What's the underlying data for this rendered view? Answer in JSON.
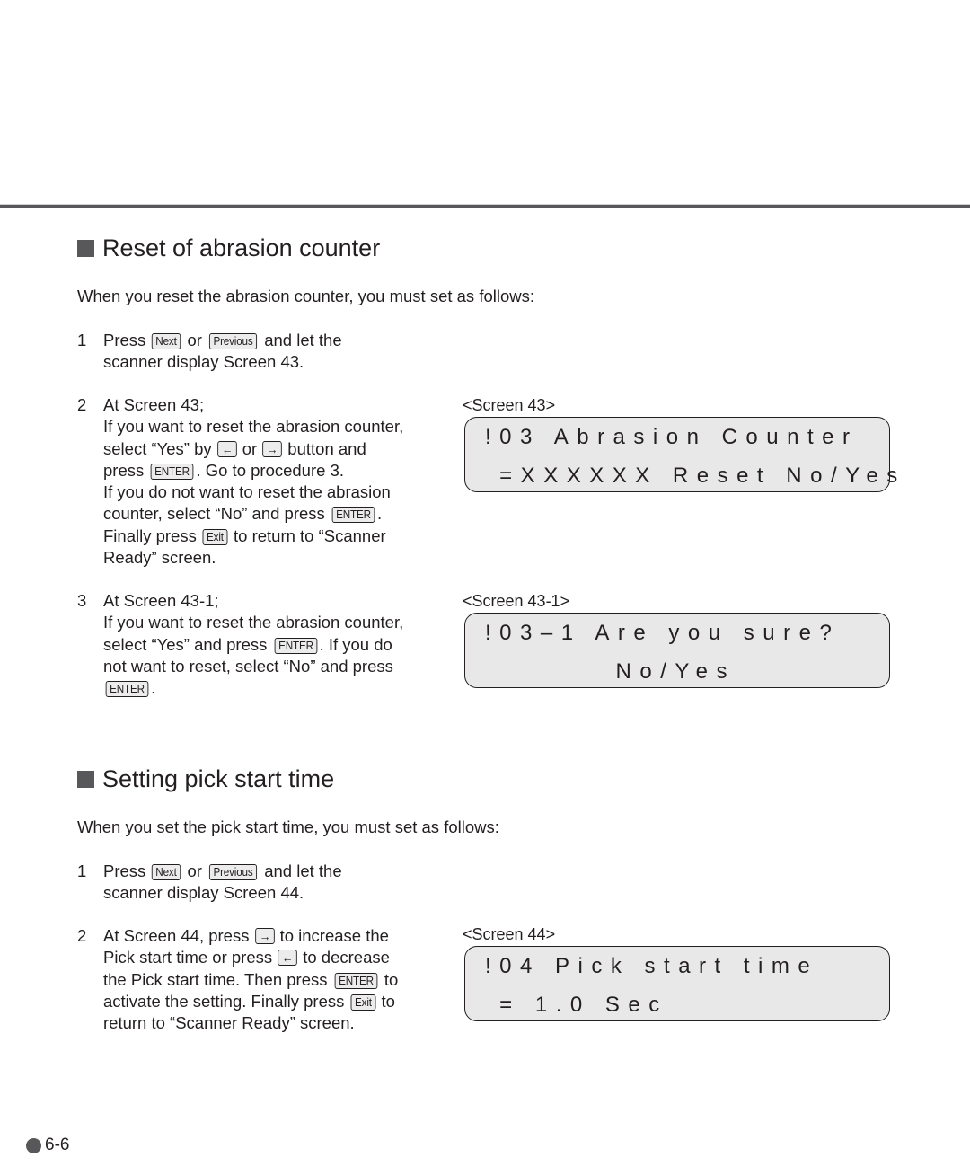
{
  "sections": [
    {
      "title": "Reset of abrasion counter",
      "intro": "When you reset the abrasion counter, you must set as follows:",
      "steps": [
        {
          "num": "1",
          "t1": "Press ",
          "k1": "Next",
          "t2": " or ",
          "k2": "Previous",
          "t3": " and let the",
          "t4": "scanner display Screen 43."
        },
        {
          "num": "2",
          "t1": "At Screen 43;",
          "t2": "If you want to reset the abrasion counter,",
          "t3": "select “Yes” by ",
          "k1": "←",
          "t4": " or ",
          "k2": "→",
          "t5": " button and",
          "t6": "press ",
          "k3": "ENTER",
          "t7": ". Go to procedure 3.",
          "t8": "If you do not want to reset the abrasion",
          "t9": "counter, select “No” and press ",
          "k4": "ENTER",
          "t10": ".",
          "t11": "Finally press ",
          "k5": "Exit",
          "t12": " to return to “Scanner",
          "t13": "Ready” screen."
        },
        {
          "num": "3",
          "t1": "At Screen 43-1;",
          "t2": "If you want to reset the abrasion counter,",
          "t3": "select “Yes” and press ",
          "k1": "ENTER",
          "t4": ". If you do",
          "t5": "not want to reset, select “No” and press",
          "k2": "ENTER",
          "t6": "."
        }
      ],
      "screens": [
        {
          "label": "<Screen 43>",
          "line1": "!03 Abrasion Counter",
          "line2": " =XXXXXX Reset No/Yes"
        },
        {
          "label": "<Screen 43-1>",
          "line1": "!03–1 Are you sure?",
          "line2": "         No/Yes"
        }
      ]
    },
    {
      "title": "Setting pick start time",
      "intro": "When you set the pick start time, you must set as follows:",
      "steps": [
        {
          "num": "1",
          "t1": "Press ",
          "k1": "Next",
          "t2": " or ",
          "k2": "Previous",
          "t3": " and let the",
          "t4": "scanner display Screen 44."
        },
        {
          "num": "2",
          "t1": "At Screen 44, press ",
          "k1": "→",
          "t2": " to increase the",
          "t3": "Pick start time or press ",
          "k2": "←",
          "t4": " to decrease",
          "t5": "the Pick start time. Then press ",
          "k3": "ENTER",
          "t6": " to",
          "t7": "activate the setting. Finally press ",
          "k4": "Exit",
          "t8": " to",
          "t9": "return to “Scanner Ready” screen."
        }
      ],
      "screens": [
        {
          "label": "<Screen 44>",
          "line1": "!04 Pick start time",
          "line2": " = 1.0 Sec"
        }
      ]
    }
  ],
  "footer": {
    "page_number": "6-6"
  }
}
